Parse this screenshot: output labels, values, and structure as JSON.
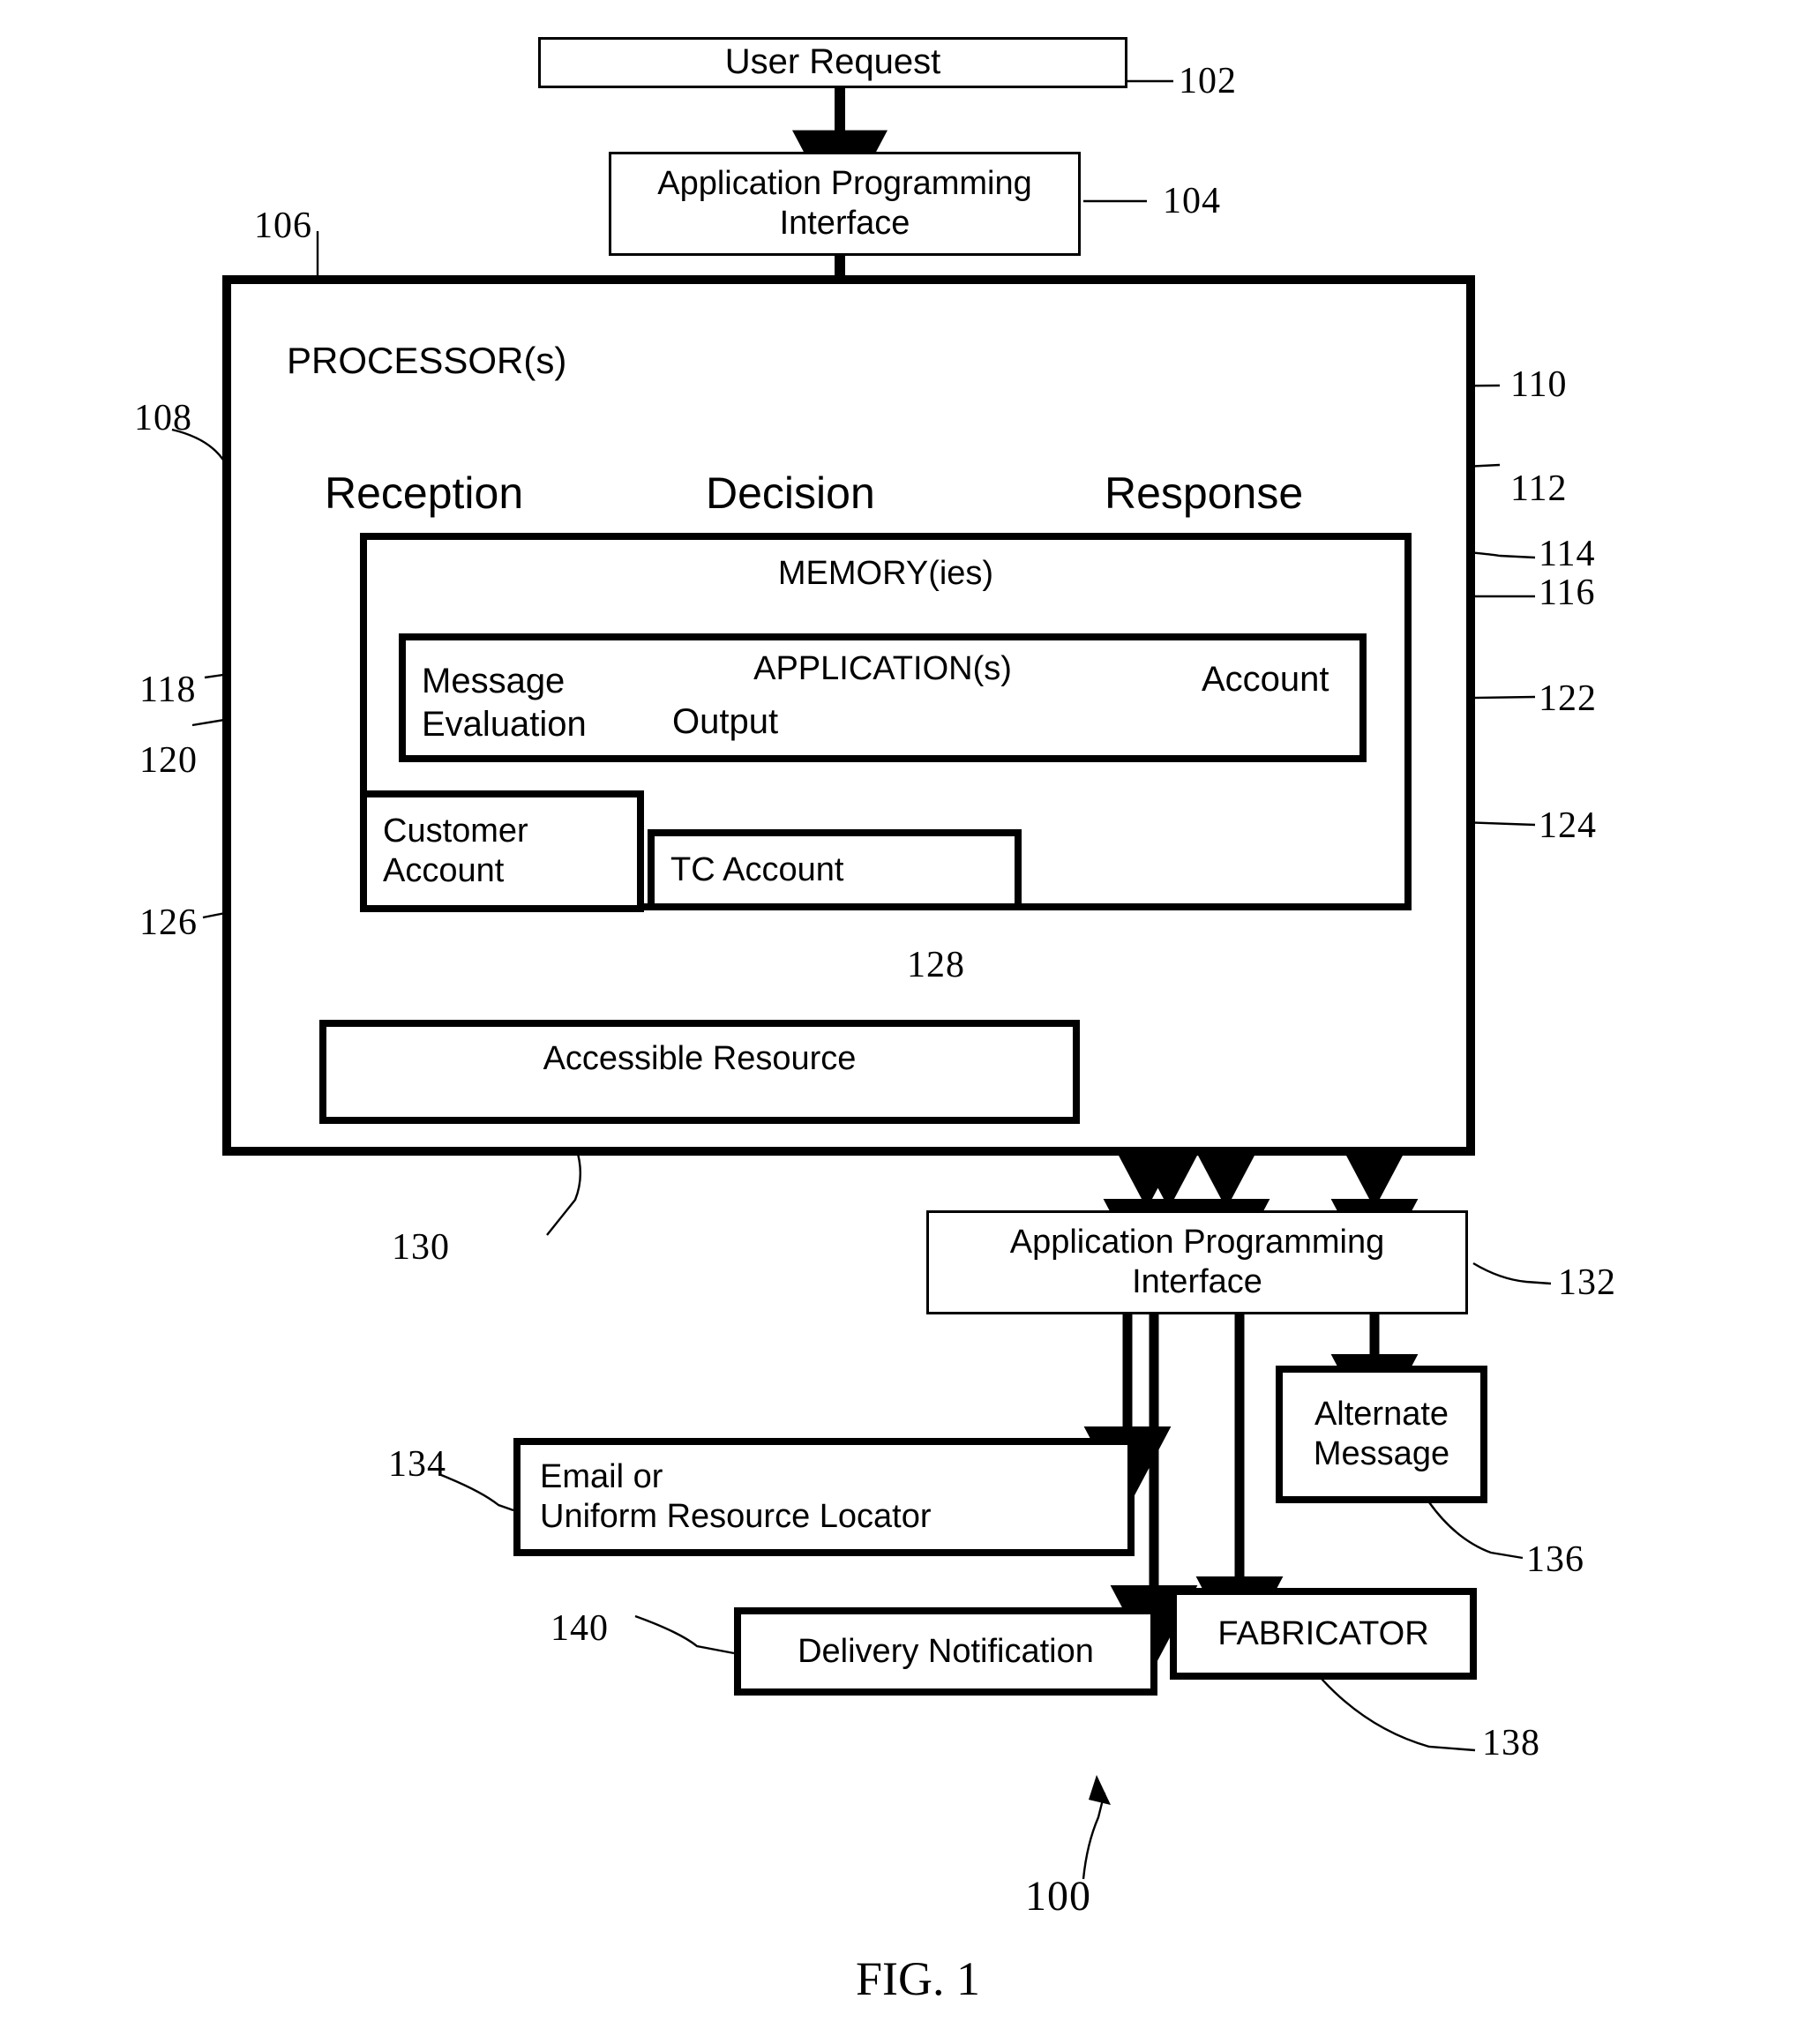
{
  "figure": {
    "caption": "FIG. 1",
    "system_ref": "100"
  },
  "nodes": {
    "user_request": {
      "label": "User Request",
      "ref": "102"
    },
    "api_top": {
      "label_line1": "Application Programming",
      "label_line2": "Interface",
      "ref": "104"
    },
    "system_boundary": {
      "ref": "106"
    },
    "processor": {
      "label": "PROCESSOR(s)",
      "ref": "108"
    },
    "reception": {
      "label": "Reception",
      "ref": "108"
    },
    "decision": {
      "label": "Decision",
      "ref": "110"
    },
    "response": {
      "label": "Response",
      "ref": "112"
    },
    "memory": {
      "label": "MEMORY(ies)",
      "ref": "114"
    },
    "applications": {
      "label": "APPLICATION(s)",
      "ref": "116"
    },
    "message_evaluation": {
      "label_line1": "Message",
      "label_line2": "Evaluation",
      "ref": "118"
    },
    "output": {
      "label": "Output",
      "ref": "120"
    },
    "account": {
      "label": "Account",
      "ref": "122"
    },
    "customer_account": {
      "label_line1": "Customer",
      "label_line2": "Account",
      "ref": "124"
    },
    "tc_account": {
      "label": "TC Account",
      "ref": "126"
    },
    "tc_account_arrow": {
      "ref": "128"
    },
    "accessible_resource": {
      "label": "Accessible Resource",
      "ref": "130"
    },
    "api_bottom": {
      "label_line1": "Application Programming",
      "label_line2": "Interface",
      "ref": "132"
    },
    "email_or_url": {
      "label_line1": "Email or",
      "label_line2": "Uniform Resource Locator",
      "ref": "134"
    },
    "alternate_message": {
      "label_line1": "Alternate",
      "label_line2": "Message",
      "ref": "136"
    },
    "fabricator": {
      "label": "FABRICATOR",
      "ref": "138"
    },
    "delivery_notification": {
      "label": "Delivery Notification",
      "ref": "140"
    }
  },
  "ref_numbers": {
    "n102": "102",
    "n104": "104",
    "n106": "106",
    "n108": "108",
    "n110": "110",
    "n112": "112",
    "n114": "114",
    "n116": "116",
    "n118": "118",
    "n120": "120",
    "n122": "122",
    "n124": "124",
    "n126": "126",
    "n128": "128",
    "n130": "130",
    "n132": "132",
    "n134": "134",
    "n136": "136",
    "n138": "138",
    "n140": "140",
    "n100": "100"
  },
  "colors": {
    "stroke": "#000000",
    "background": "#ffffff"
  }
}
